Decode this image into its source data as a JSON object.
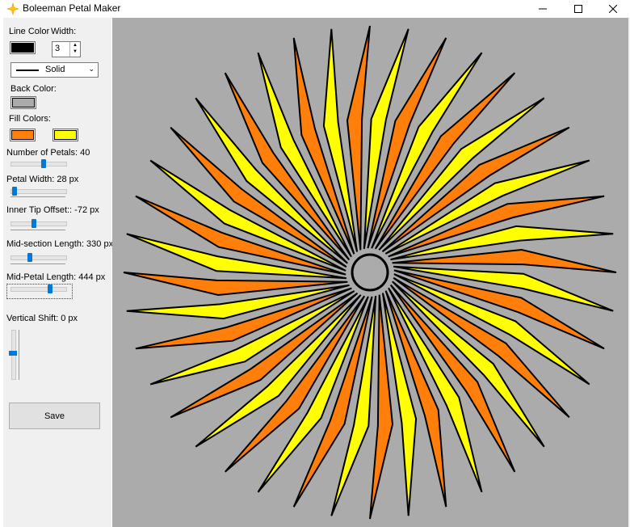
{
  "window": {
    "title": "Boleeman Petal Maker"
  },
  "controls": {
    "line_color_label": "Line Color",
    "width_label": "Width:",
    "width_value": "3",
    "line_style": "Solid",
    "back_color_label": "Back Color:",
    "fill_colors_label": "Fill Colors:",
    "number_of_petals_label": "Number of Petals: 40",
    "petal_width_label": "Petal Width: 28 px",
    "inner_tip_offset_label": "Inner Tip Offset:: -72 px",
    "mid_section_length_label": "Mid-section Length: 330 px",
    "mid_petal_length_label": "Mid-Petal Length: 444 px",
    "vertical_shift_label": "Vertical Shift: 0 px",
    "save_label": "Save"
  },
  "colors": {
    "line": "#000000",
    "back": "#ababab",
    "fill1": "#ff7f0a",
    "fill2": "#ffff00"
  },
  "drawing": {
    "petal_count": 40,
    "rotation_direction": "clockwise"
  }
}
